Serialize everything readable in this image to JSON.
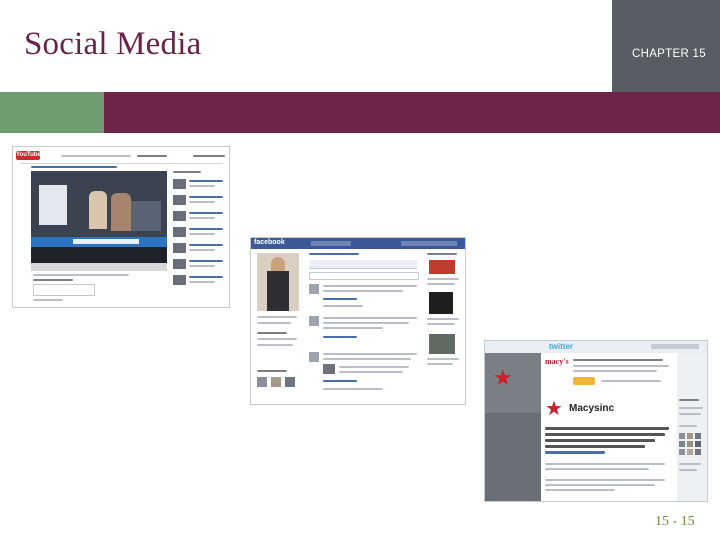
{
  "slide": {
    "title": "Social Media",
    "chapter": "CHAPTER 15",
    "page_number": "15 - 15"
  },
  "screenshots": {
    "youtube": {
      "logo_text": "YouTube",
      "video_caption": "The Spelling Tools at Bee Bench Experimental",
      "ticker_text": "FF Headline offer TT Sentence"
    },
    "facebook": {
      "logo_text": "facebook"
    },
    "twitter": {
      "logo_text": "twitter",
      "brand": "macy's",
      "profile_name": "Macysinc",
      "banner_heading": "Get short, timely messages from Macy's.",
      "tweet_text": "Hey NYC! Meet @Jessica on Macy's for a charity signed by the Nike... Aug 26th"
    },
    "colors": {
      "title": "#6b2148",
      "band": "#6e2448",
      "band_accent": "#6e9d72",
      "chapter_box": "#575d63",
      "page_number": "#6e8b3d",
      "facebook_blue": "#3b5998",
      "youtube_red": "#c4302b",
      "macys_red": "#cc1f2f"
    }
  }
}
